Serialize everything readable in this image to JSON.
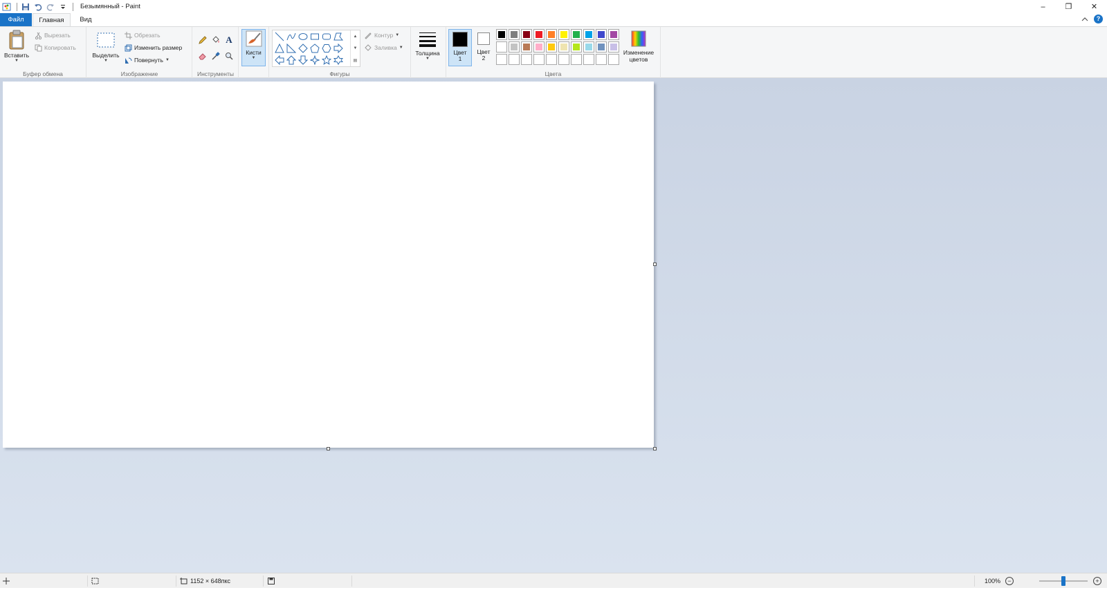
{
  "window": {
    "title": "Безымянный - Paint",
    "controls": {
      "minimize": "–",
      "restore": "❐",
      "close": "✕"
    }
  },
  "quick_access": [
    "paint-app-icon",
    "save-icon",
    "undo-icon",
    "redo-icon",
    "customize-icon"
  ],
  "tabs": {
    "file": "Файл",
    "home": "Главная",
    "view": "Вид"
  },
  "ribbon": {
    "clipboard": {
      "label": "Буфер обмена",
      "paste": "Вставить",
      "cut": "Вырезать",
      "copy": "Копировать"
    },
    "image": {
      "label": "Изображение",
      "select": "Выделить",
      "crop": "Обрезать",
      "resize": "Изменить размер",
      "rotate": "Повернуть"
    },
    "tools": {
      "label": "Инструменты",
      "items": [
        "pencil-icon",
        "fill-icon",
        "text-icon",
        "eraser-icon",
        "color-picker-icon",
        "magnifier-icon"
      ]
    },
    "brushes": {
      "label": "Кисти"
    },
    "shapes": {
      "label": "Фигуры",
      "outline": "Контур",
      "fill": "Заливка"
    },
    "size": {
      "label": "Толщина"
    },
    "colors": {
      "label": "Цвета",
      "color1_line1": "Цвет",
      "color1_line2": "1",
      "color2_line1": "Цвет",
      "color2_line2": "2",
      "color1_value": "#000000",
      "color2_value": "#ffffff",
      "edit_line1": "Изменение",
      "edit_line2": "цветов",
      "palette_row1": [
        "#000000",
        "#7f7f7f",
        "#880015",
        "#ed1c24",
        "#ff7f27",
        "#fff200",
        "#22b14c",
        "#00a2e8",
        "#3f48cc",
        "#a349a4"
      ],
      "palette_row2": [
        "#ffffff",
        "#c3c3c3",
        "#b97a57",
        "#ffaec9",
        "#ffc90e",
        "#efe4b0",
        "#b5e61d",
        "#99d9ea",
        "#7092be",
        "#c8bfe7"
      ],
      "palette_row3": [
        "",
        "",
        "",
        "",
        "",
        "",
        "",
        "",
        "",
        ""
      ]
    }
  },
  "status": {
    "canvas_size": "1152 × 648пкс",
    "zoom": "100%"
  }
}
